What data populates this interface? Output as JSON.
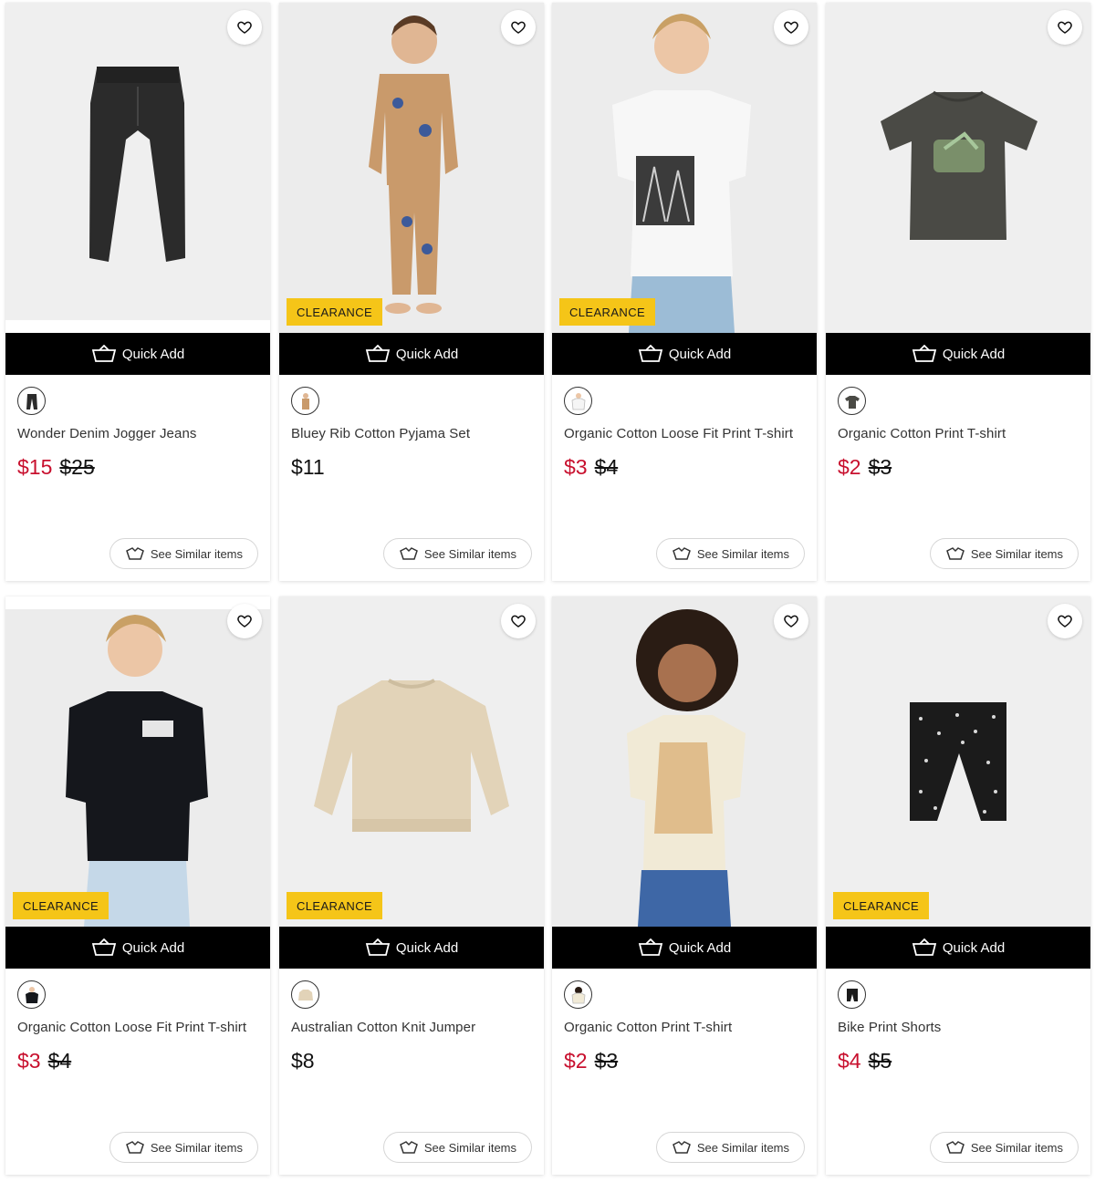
{
  "labels": {
    "quick_add": "Quick Add",
    "see_similar": "See Similar items",
    "clearance": "CLEARANCE"
  },
  "products": [
    {
      "name": "Wonder Denim Jogger Jeans",
      "sale_price": "$15",
      "old_price": "$25",
      "clearance": false,
      "item": "jeans",
      "color": "#2b2b2b"
    },
    {
      "name": "Bluey Rib Cotton Pyjama Set",
      "price": "$11",
      "clearance": true,
      "item": "pyjama",
      "color": "#c99a6b"
    },
    {
      "name": "Organic Cotton Loose Fit Print T-shirt",
      "sale_price": "$3",
      "old_price": "$4",
      "clearance": true,
      "item": "tee-white",
      "color": "#f5f5f5"
    },
    {
      "name": "Organic Cotton Print T-shirt",
      "sale_price": "$2",
      "old_price": "$3",
      "clearance": false,
      "item": "tee-charcoal",
      "color": "#4a4a45"
    },
    {
      "name": "Organic Cotton Loose Fit Print T-shirt",
      "sale_price": "$3",
      "old_price": "$4",
      "clearance": true,
      "item": "tee-black",
      "color": "#15171c"
    },
    {
      "name": "Australian Cotton Knit Jumper",
      "price": "$8",
      "clearance": true,
      "item": "jumper",
      "color": "#e2d3b8"
    },
    {
      "name": "Organic Cotton Print T-shirt",
      "sale_price": "$2",
      "old_price": "$3",
      "clearance": false,
      "item": "tee-cream",
      "color": "#f1ead6"
    },
    {
      "name": "Bike Print Shorts",
      "sale_price": "$4",
      "old_price": "$5",
      "clearance": true,
      "item": "shorts",
      "color": "#1b1b1b"
    }
  ]
}
